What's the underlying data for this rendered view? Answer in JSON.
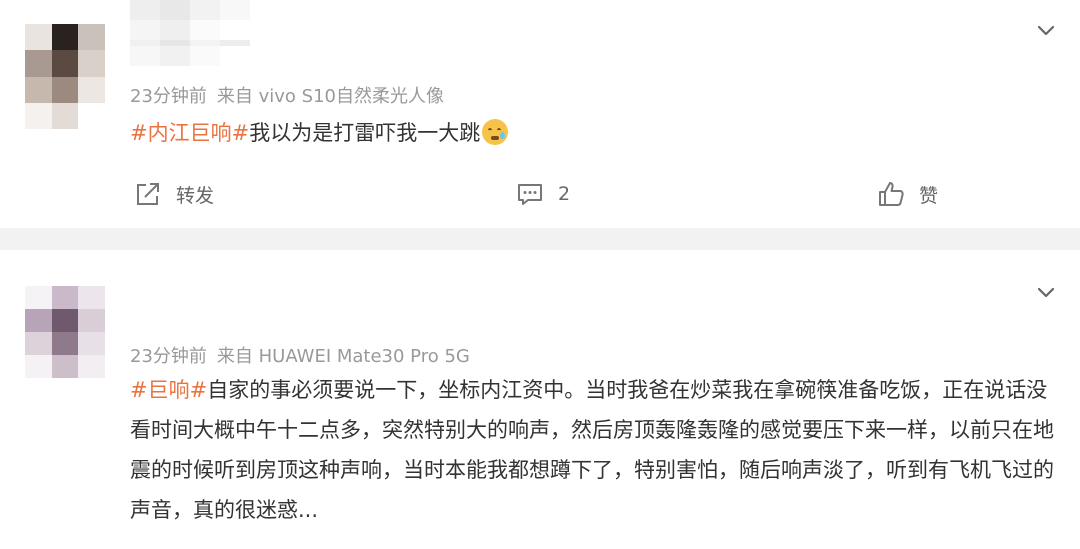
{
  "posts": [
    {
      "time": "23分钟前",
      "source": "来自 vivo S10自然柔光人像",
      "hashtag": "#内江巨响#",
      "text": "我以为是打雷吓我一大跳",
      "emoji": "crying-face",
      "actions": {
        "forward_label": "转发",
        "comment_count": "2",
        "like_label": "赞"
      }
    },
    {
      "time": "23分钟前",
      "source": "来自 HUAWEI Mate30 Pro 5G",
      "hashtag": "#巨响#",
      "text": "自家的事必须要说一下，坐标内江资中。当时我爸在炒菜我在拿碗筷准备吃饭，正在说话没看时间大概中午十二点多，突然特别大的响声，然后房顶轰隆轰隆的感觉要压下来一样，以前只在地震的时候听到房顶这种声响，当时本能我都想蹲下了，特别害怕，随后响声淡了，听到有飞机飞过的声音，真的很迷惑..."
    }
  ],
  "colors": {
    "hashtag": "#eb7340",
    "meta": "#999999",
    "text": "#333333",
    "divider": "#f2f2f2"
  },
  "icons": {
    "menu": "chevron-down-icon",
    "forward": "share-icon",
    "comment": "comment-icon",
    "like": "thumbs-up-icon"
  }
}
